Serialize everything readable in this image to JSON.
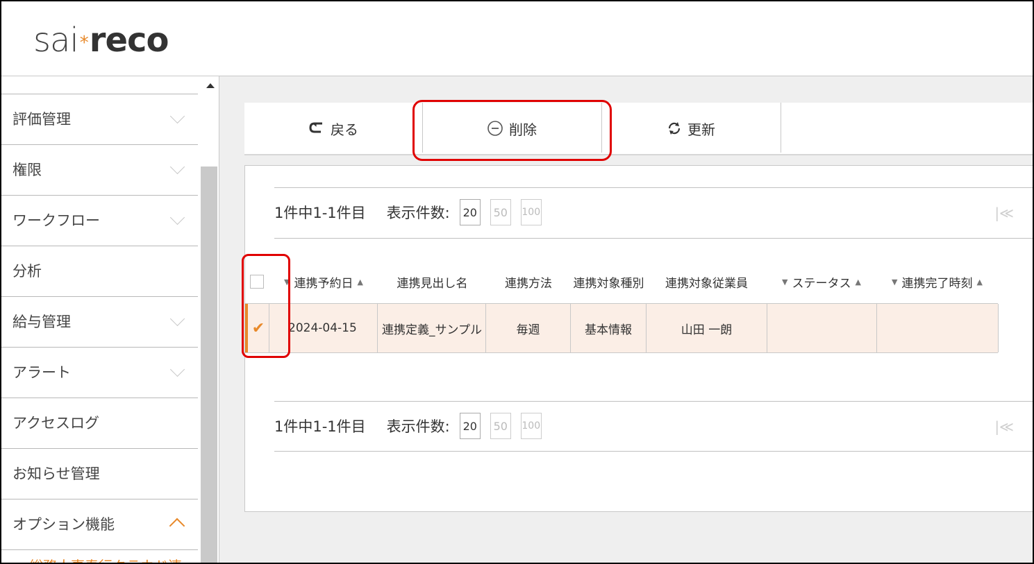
{
  "app": {
    "logo_part1": "sai",
    "logo_star": "*",
    "logo_part2": "reco"
  },
  "sidebar": {
    "items": [
      {
        "label": "評価管理",
        "expanded": false
      },
      {
        "label": "権限",
        "expanded": false
      },
      {
        "label": "ワークフロー",
        "expanded": false
      },
      {
        "label": "分析",
        "expanded": null
      },
      {
        "label": "給与管理",
        "expanded": false
      },
      {
        "label": "アラート",
        "expanded": false
      },
      {
        "label": "アクセスログ",
        "expanded": null
      },
      {
        "label": "お知らせ管理",
        "expanded": null
      },
      {
        "label": "オプション機能",
        "expanded": true
      }
    ],
    "sub_item_partial": "総務人事奉行クラウド連"
  },
  "toolbar": {
    "back_label": "戻る",
    "delete_label": "削除",
    "refresh_label": "更新"
  },
  "pager": {
    "count_text": "1件中1-1件目",
    "per_page_label": "表示件数:",
    "options": [
      "20",
      "50",
      "100"
    ],
    "selected": "20",
    "first_icon": "|≪"
  },
  "table": {
    "columns": [
      "連携予約日",
      "連携見出し名",
      "連携方法",
      "連携対象種別",
      "連携対象従業員",
      "ステータス",
      "連携完了時刻"
    ],
    "rows": [
      {
        "checked": true,
        "date": "2024-04-15",
        "title": "連携定義_サンプル",
        "method": "毎週",
        "target_type": "基本情報",
        "employee": "山田 一朗",
        "status": "",
        "completed": ""
      }
    ]
  },
  "colors": {
    "accent": "#e8892a",
    "highlight": "#e00000",
    "row_selected": "#fbeee6"
  }
}
